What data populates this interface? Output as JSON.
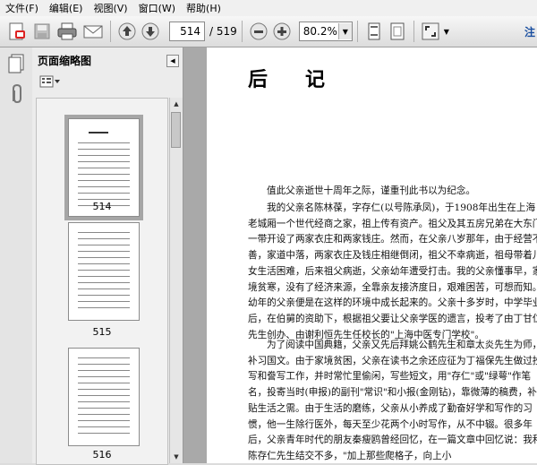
{
  "menu": [
    "文件(F)",
    "编辑(E)",
    "视图(V)",
    "窗口(W)",
    "帮助(H)"
  ],
  "toolbar": {
    "page_current": "514",
    "page_total": "/ 519",
    "zoom": "80.2%",
    "note_label": "注"
  },
  "icons": [
    "create-pdf-icon",
    "save-icon",
    "print-icon",
    "email-icon",
    "prev-page-icon",
    "next-page-icon",
    "zoom-out-icon",
    "zoom-in-icon",
    "single-page-icon",
    "fit-page-icon",
    "fullscreen-icon"
  ],
  "panel": {
    "title": "页面缩略图",
    "thumbnails": [
      {
        "label": "514",
        "selected": true
      },
      {
        "label": "515",
        "selected": false
      },
      {
        "label": "516",
        "selected": false
      }
    ]
  },
  "document": {
    "heading": "后记",
    "paragraphs": [
      "值此父亲逝世十周年之际，谨重刊此书以为纪念。",
      "我的父亲名陈林葆，字存仁(以号陈承凤)，于1908年出生在上海老城厢一个世代经商之家，祖上传有资产。祖父及其五房兄弟在大东门一带开设了两家衣庄和两家钱庄。然而，在父亲八岁那年，由于经营不善，家道中落，两家衣庄及钱庄相继倒闭，祖父不幸病逝，祖母带着儿女生活困难，后来祖父病逝，父亲幼年遭受打击。我的父亲懂事早，家境贫寒，没有了经济来源，全靠亲友接济度日，艰难困苦，可想而知。幼年的父亲便是在这样的环境中成长起来的。父亲十多岁时，中学毕业后，在伯舅的资助下，根据祖父要让父亲学医的遗言，投考了由丁甘仁先生创办、由谢利恒先生任校长的\"上海中医专门学校\"。",
      "为了阅读中国典籍，父亲又先后拜姚公鹤先生和章太炎先生为师，补习国文。由于家境贫困，父亲在读书之余还应征为丁福保先生做过抄写和誊写工作，并时常忙里偷闲，写些短文，用\"存仁\"或\"绿萼\"作笔名，投寄当时(申报)的副刊\"常识\"和小报(金刚钻)，靠微薄的稿费，补贴生活之需。由于生活的磨练，父亲从小养成了勤奋好学和写作的习惯，他一生除行医外，每天至少花两个小时写作，从不中辍。很多年后，父亲青年时代的朋友秦瘦鸥曾经回忆，在一篇文章中回忆说：我和陈存仁先生结交不多，\"加上那些爬格子，向上小"
    ]
  }
}
